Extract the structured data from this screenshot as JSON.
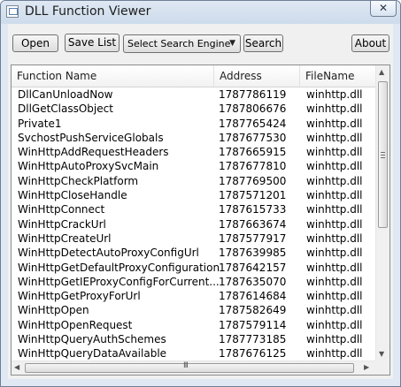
{
  "window": {
    "title": "DLL Function Viewer",
    "close_label": "✕"
  },
  "toolbar": {
    "open_label": "Open",
    "save_label": "Save List",
    "search_engine_selected": "Select Search Engine",
    "search_label": "Search",
    "about_label": "About"
  },
  "list": {
    "columns": [
      "Function Name",
      "Address",
      "FileName"
    ],
    "rows": [
      [
        "DllCanUnloadNow",
        "1787786119",
        "winhttp.dll"
      ],
      [
        "DllGetClassObject",
        "1787806676",
        "winhttp.dll"
      ],
      [
        "Private1",
        "1787765424",
        "winhttp.dll"
      ],
      [
        "SvchostPushServiceGlobals",
        "1787677530",
        "winhttp.dll"
      ],
      [
        "WinHttpAddRequestHeaders",
        "1787665915",
        "winhttp.dll"
      ],
      [
        "WinHttpAutoProxySvcMain",
        "1787677810",
        "winhttp.dll"
      ],
      [
        "WinHttpCheckPlatform",
        "1787769500",
        "winhttp.dll"
      ],
      [
        "WinHttpCloseHandle",
        "1787571201",
        "winhttp.dll"
      ],
      [
        "WinHttpConnect",
        "1787615733",
        "winhttp.dll"
      ],
      [
        "WinHttpCrackUrl",
        "1787663674",
        "winhttp.dll"
      ],
      [
        "WinHttpCreateUrl",
        "1787577917",
        "winhttp.dll"
      ],
      [
        "WinHttpDetectAutoProxyConfigUrl",
        "1787639985",
        "winhttp.dll"
      ],
      [
        "WinHttpGetDefaultProxyConfiguration",
        "1787642157",
        "winhttp.dll"
      ],
      [
        "WinHttpGetIEProxyConfigForCurrent...",
        "1787635070",
        "winhttp.dll"
      ],
      [
        "WinHttpGetProxyForUrl",
        "1787614684",
        "winhttp.dll"
      ],
      [
        "WinHttpOpen",
        "1787582649",
        "winhttp.dll"
      ],
      [
        "WinHttpOpenRequest",
        "1787579114",
        "winhttp.dll"
      ],
      [
        "WinHttpQueryAuthSchemes",
        "1787773185",
        "winhttp.dll"
      ],
      [
        "WinHttpQueryDataAvailable",
        "1787676125",
        "winhttp.dll"
      ]
    ]
  },
  "scrollbar": {
    "up_arrow": "▲",
    "down_arrow": "▼",
    "left_arrow": "◀",
    "right_arrow": "▶",
    "h_thumb_grip": "III"
  }
}
